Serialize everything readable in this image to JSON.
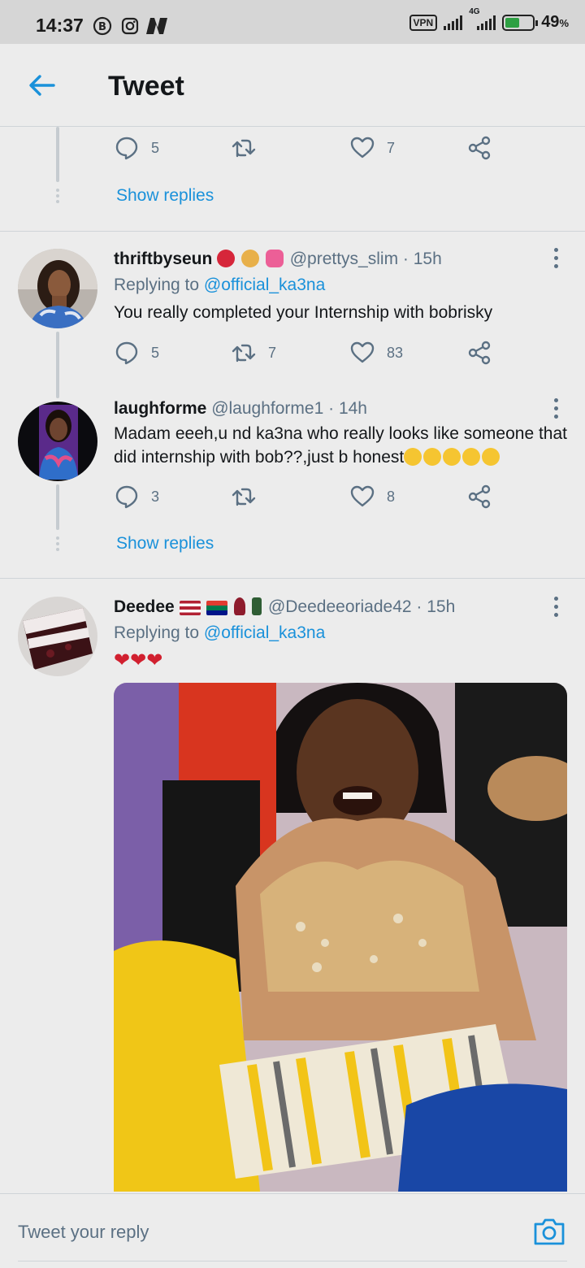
{
  "status_bar": {
    "time": "14:37",
    "vpn": "VPN",
    "network": "4G",
    "battery_percent": "49",
    "battery_unit": "%"
  },
  "header": {
    "title": "Tweet"
  },
  "colors": {
    "accent": "#1a91da",
    "muted": "#5b7083",
    "background": "#ececec"
  },
  "top_actions": {
    "replies": "5",
    "retweets": "",
    "likes": "7"
  },
  "show_replies_1": "Show replies",
  "tweets": [
    {
      "name": "thriftbyseun",
      "handle": "@prettys_slim",
      "time": "15h",
      "replying_prefix": "Replying to",
      "replying_to": "@official_ka3na",
      "text": "You really completed your Internship with bobrisky",
      "replies": "5",
      "retweets": "7",
      "likes": "83"
    },
    {
      "name": "laughforme",
      "handle": "@laughforme1",
      "time": "14h",
      "text": "Madam eeeh,u nd ka3na who really looks like someone that did internship with bob??,just b honest",
      "replies": "3",
      "retweets": "",
      "likes": "8"
    },
    {
      "name": "Deedee",
      "handle": "@Deedeeoriade42",
      "time": "15h",
      "replying_prefix": "Replying to",
      "replying_to": "@official_ka3na",
      "text": "❤❤❤"
    }
  ],
  "show_replies_2": "Show replies",
  "reply_bar": {
    "placeholder": "Tweet your reply"
  },
  "separator": "·"
}
